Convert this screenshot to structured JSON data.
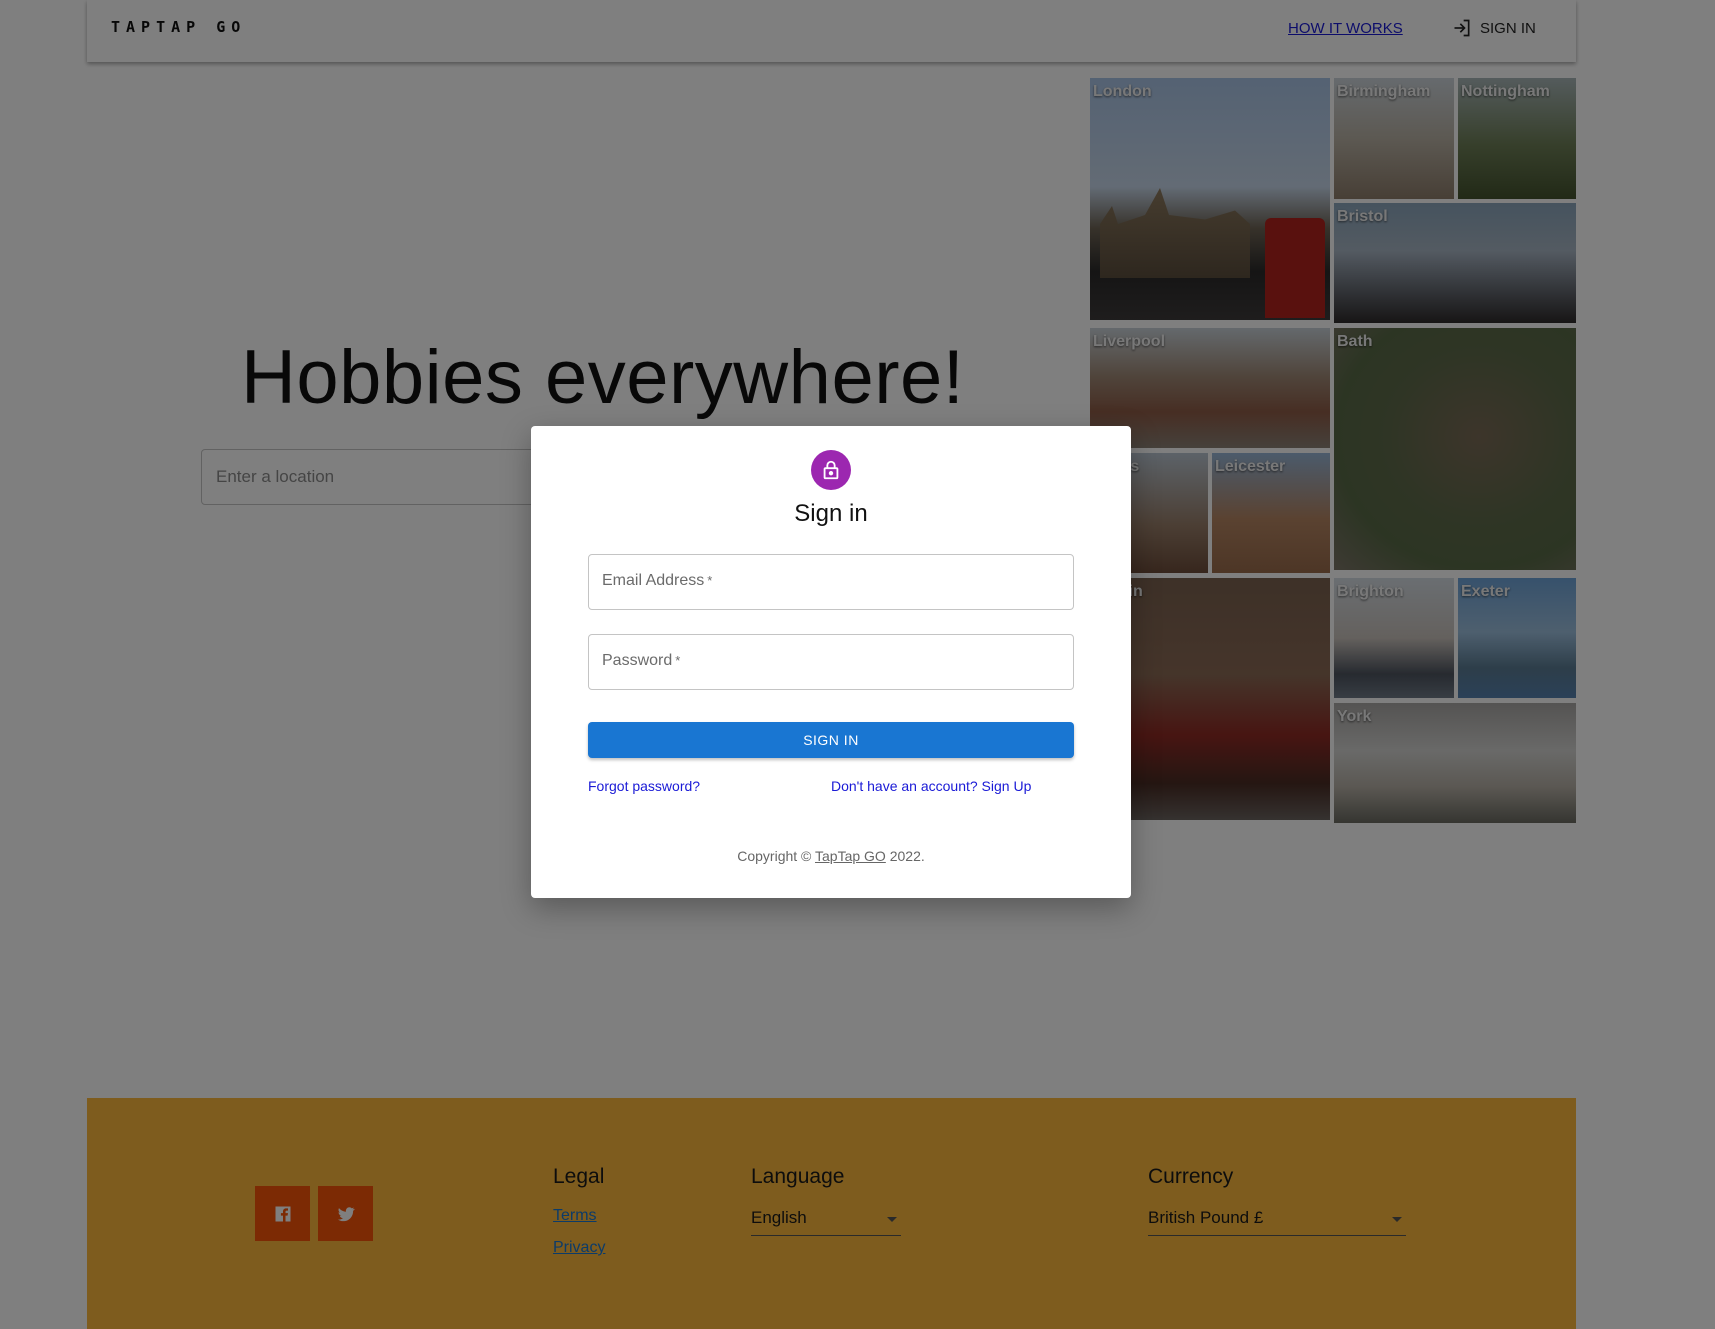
{
  "header": {
    "logo": "TAPTAP GO",
    "how_it_works": "HOW IT WORKS",
    "sign_in": "SIGN IN"
  },
  "hero": {
    "title": "Hobbies everywhere!",
    "location_placeholder": "Enter a location"
  },
  "cities": [
    {
      "name": "London"
    },
    {
      "name": "Birmingham"
    },
    {
      "name": "Nottingham"
    },
    {
      "name": "Bristol"
    },
    {
      "name": "Liverpool"
    },
    {
      "name": "Bath"
    },
    {
      "name": "Leeds"
    },
    {
      "name": "Leicester"
    },
    {
      "name": "Dublin"
    },
    {
      "name": "Brighton"
    },
    {
      "name": "Exeter"
    },
    {
      "name": "York"
    }
  ],
  "modal": {
    "title": "Sign in",
    "email_label": "Email Address",
    "password_label": "Password",
    "required_mark": "*",
    "submit": "SIGN IN",
    "forgot": "Forgot password?",
    "signup": "Don't have an account? Sign Up",
    "copyright_prefix": "Copyright © ",
    "copyright_brand": "TapTap GO",
    "copyright_suffix": " 2022."
  },
  "footer": {
    "legal_heading": "Legal",
    "terms": "Terms",
    "privacy": "Privacy",
    "language_heading": "Language",
    "language_value": "English",
    "currency_heading": "Currency",
    "currency_value": "British Pound £",
    "social": [
      "facebook-icon",
      "twitter-icon"
    ]
  },
  "colors": {
    "footer_bg": "#fdb93c",
    "social_bg": "#f95509",
    "primary": "#1976d2",
    "lock_avatar": "#9c27b0",
    "link": "#1a1ad6"
  }
}
